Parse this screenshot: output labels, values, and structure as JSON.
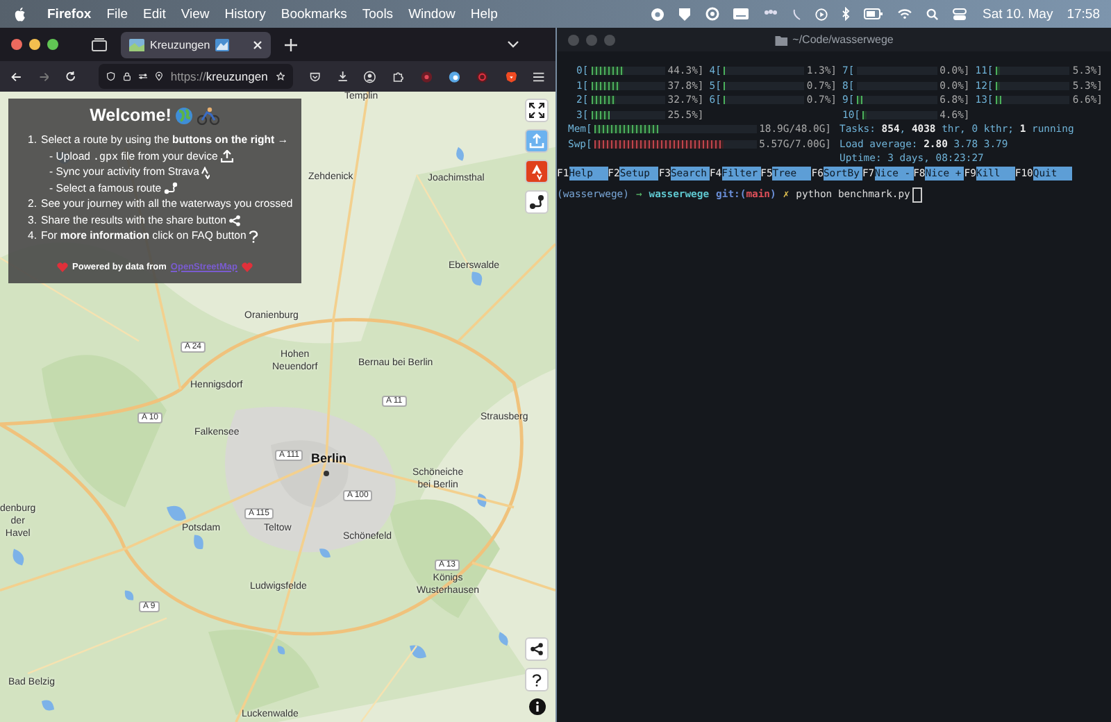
{
  "menu_bar": {
    "app": "Firefox",
    "menus": [
      "File",
      "Edit",
      "View",
      "History",
      "Bookmarks",
      "Tools",
      "Window",
      "Help"
    ],
    "date": "Sat 10. May",
    "time": "17:58"
  },
  "browser": {
    "tab": {
      "title": "Kreuzungen",
      "selected": true
    },
    "url_scheme": "https://",
    "url_host": "kreuzungen"
  },
  "welcome": {
    "title": "Welcome!",
    "steps": [
      {
        "number": "1.",
        "text": "Select a route by using the **buttons on the right** →",
        "sub": [
          {
            "before": "- Upload",
            "code": ".gpx",
            "after": "file from your device"
          },
          {
            "before": "- Sync your activity from Strava"
          },
          {
            "before": "- Select a famous route"
          }
        ]
      },
      {
        "number": "2.",
        "text": "See your journey with all the waterways you crossed"
      },
      {
        "number": "3.",
        "text": "Share the results with the share button"
      },
      {
        "number": "4.",
        "text": "For **more information** click on FAQ button"
      }
    ],
    "credit": "Powered by data from",
    "credit_link": "OpenStreetMap"
  },
  "map": {
    "places": [
      {
        "name": "Templin",
        "kind": "town"
      },
      {
        "name": "Zehdenick",
        "kind": "town"
      },
      {
        "name": "Joachimsthal",
        "kind": "town"
      },
      {
        "name": "Eberswalde",
        "kind": "town"
      },
      {
        "name": "Oranienburg",
        "kind": "town"
      },
      {
        "name": "A 24",
        "kind": "road"
      },
      {
        "name": "Hohen Neuendorf",
        "kind": "town"
      },
      {
        "name": "Bernau bei Berlin",
        "kind": "town"
      },
      {
        "name": "Hennigsdorf",
        "kind": "town"
      },
      {
        "name": "A 11",
        "kind": "road"
      },
      {
        "name": "A 10",
        "kind": "road"
      },
      {
        "name": "Strausberg",
        "kind": "town"
      },
      {
        "name": "Falkensee",
        "kind": "town"
      },
      {
        "name": "A 111",
        "kind": "road"
      },
      {
        "name": "Berlin",
        "kind": "city"
      },
      {
        "name": "Schöneiche bei Berlin",
        "kind": "town"
      },
      {
        "name": "A 100",
        "kind": "road"
      },
      {
        "name": "denburg der Havel",
        "kind": "town"
      },
      {
        "name": "A 115",
        "kind": "road"
      },
      {
        "name": "Potsdam",
        "kind": "town"
      },
      {
        "name": "Teltow",
        "kind": "town"
      },
      {
        "name": "Schönefeld",
        "kind": "town"
      },
      {
        "name": "A 13",
        "kind": "road"
      },
      {
        "name": "Ludwigsfelde",
        "kind": "town"
      },
      {
        "name": "Königs Wusterhausen",
        "kind": "town"
      },
      {
        "name": "A 9",
        "kind": "road"
      },
      {
        "name": "Bad Belzig",
        "kind": "town"
      },
      {
        "name": "Luckenwalde",
        "kind": "town"
      }
    ],
    "controls_top": [
      {
        "kind": "fullscreen"
      },
      {
        "kind": "upload"
      },
      {
        "kind": "strava"
      },
      {
        "kind": "route"
      }
    ],
    "controls_bottom": [
      {
        "kind": "share"
      },
      {
        "kind": "faq"
      },
      {
        "kind": "info"
      }
    ]
  },
  "terminal": {
    "title": "~/Code/wasserwege",
    "cpus": [
      {
        "label": "0[",
        "level": 0.443,
        "reading": "44.3%]"
      },
      {
        "label": "1[",
        "level": 0.378,
        "reading": "37.8%]"
      },
      {
        "label": "2[",
        "level": 0.327,
        "reading": "32.7%]"
      },
      {
        "label": "3[",
        "level": 0.255,
        "reading": "25.5%]"
      },
      {
        "label": "4[",
        "level": 0.013,
        "reading": "1.3%]"
      },
      {
        "label": "5[",
        "level": 0.007,
        "reading": "0.7%]"
      },
      {
        "label": "6[",
        "level": 0.007,
        "reading": "0.7%]"
      },
      {
        "label": "7[",
        "reading": "0.0%]"
      },
      {
        "label": "8[",
        "reading": "0.0%]"
      },
      {
        "label": "9[",
        "level": 0.068,
        "reading": "6.8%]"
      },
      {
        "label": "10[",
        "level": 0.046,
        "reading": "4.6%]"
      },
      {
        "label": "11[",
        "level": 0.053,
        "reading": "5.3%]"
      },
      {
        "label": "12[",
        "level": 0.053,
        "reading": "5.3%]"
      },
      {
        "label": "13[",
        "level": 0.066,
        "reading": "6.6%]"
      }
    ],
    "mem": {
      "label": "Mem[",
      "level": 0.39,
      "reading": "18.9G/48.0G]"
    },
    "swap": {
      "label": "Swp[",
      "level": 0.8,
      "reading": "5.57G/7.00G]"
    },
    "tasks": "Tasks: **854**, **4038** thr, 0 kthr; **1** running",
    "load": "Load average: **2.80** 3.78 3.79",
    "uptime": "Uptime: 3 days, 08:23:27",
    "fkeys": [
      {
        "key": "F1",
        "label": "Help"
      },
      {
        "key": "F2",
        "label": "Setup"
      },
      {
        "key": "F3",
        "label": "Search"
      },
      {
        "key": "F4",
        "label": "Filter"
      },
      {
        "key": "F5",
        "label": "Tree"
      },
      {
        "key": "F6",
        "label": "SortBy"
      },
      {
        "key": "F7",
        "label": "Nice -"
      },
      {
        "key": "F8",
        "label": "Nice +"
      },
      {
        "key": "F9",
        "label": "Kill"
      },
      {
        "key": "F10",
        "label": "Quit"
      }
    ],
    "prompt": {
      "env": "(wasserwege)",
      "arrow": "→",
      "dir": "wasserwege",
      "git_open": "git:(",
      "branch": "main",
      "git_close": ")",
      "dirty": "✗",
      "command": "python benchmark.py"
    }
  }
}
